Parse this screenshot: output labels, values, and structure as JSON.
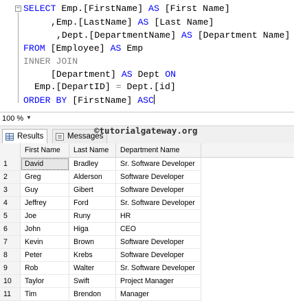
{
  "editor": {
    "lines": [
      {
        "kw": "SELECT",
        "text": " Emp.[FirstName] ",
        "kw2": "AS",
        "text2": " [First Name]"
      },
      {
        "text": ",Emp.[LastName] ",
        "kw2": "AS",
        "text2": " [Last Name]"
      },
      {
        "text": ",Dept.[DepartmentName] ",
        "kw2": "AS",
        "text2": " [Department Name]"
      },
      {
        "kw": "FROM",
        "text": " [Employee] ",
        "kw2": "AS",
        "text2": " Emp"
      },
      {
        "gray": "INNER JOIN"
      },
      {
        "text": "[Department] ",
        "kw2": "AS",
        "text2": " Dept ",
        "kw3": "ON"
      },
      {
        "text": "Emp.[DepartID] ",
        "gray2": "=",
        "text2": " Dept.[id]"
      },
      {
        "kw": "ORDER BY",
        "text": " [FirstName] ",
        "kw2": "ASC"
      }
    ]
  },
  "zoom": {
    "value": "100 %"
  },
  "tabs": {
    "results": "Results",
    "messages": "Messages"
  },
  "watermark": "©tutorialgateway.org",
  "grid": {
    "columns": [
      "First Name",
      "Last Name",
      "Department Name"
    ],
    "rows": [
      {
        "n": "1",
        "first": "David",
        "last": "Bradley",
        "dept": "Sr. Software Developer"
      },
      {
        "n": "2",
        "first": "Greg",
        "last": "Alderson",
        "dept": "Software Developer"
      },
      {
        "n": "3",
        "first": "Guy",
        "last": "Gibert",
        "dept": "Software Developer"
      },
      {
        "n": "4",
        "first": "Jeffrey",
        "last": "Ford",
        "dept": "Sr. Software Developer"
      },
      {
        "n": "5",
        "first": "Joe",
        "last": "Runy",
        "dept": "HR"
      },
      {
        "n": "6",
        "first": "John",
        "last": "Higa",
        "dept": "CEO"
      },
      {
        "n": "7",
        "first": "Kevin",
        "last": "Brown",
        "dept": "Software Developer"
      },
      {
        "n": "8",
        "first": "Peter",
        "last": "Krebs",
        "dept": "Software Developer"
      },
      {
        "n": "9",
        "first": "Rob",
        "last": "Walter",
        "dept": "Sr. Software Developer"
      },
      {
        "n": "10",
        "first": "Taylor",
        "last": "Swift",
        "dept": "Project Manager"
      },
      {
        "n": "11",
        "first": "Tim",
        "last": "Brendon",
        "dept": "Manager"
      }
    ]
  }
}
